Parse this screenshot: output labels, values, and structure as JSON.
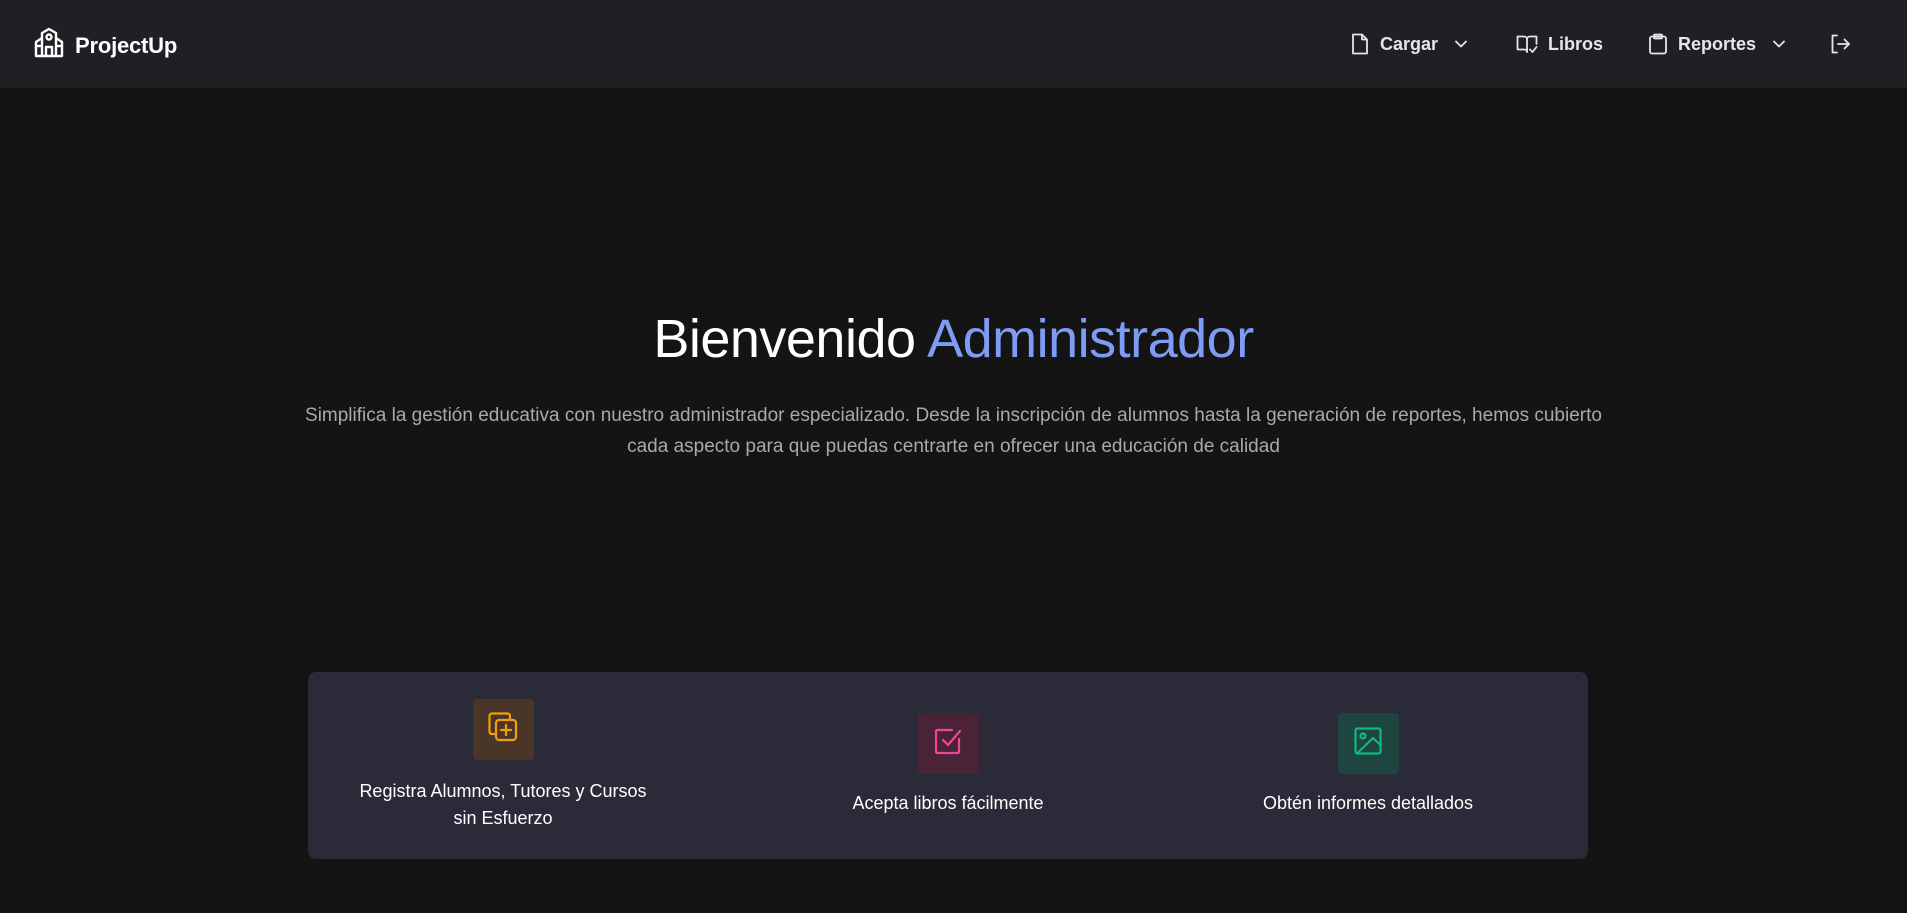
{
  "nav": {
    "brand": "ProjectUp",
    "brand_icon": "school-building-icon",
    "items": [
      {
        "label": "Cargar",
        "icon": "file-icon",
        "has_dropdown": true
      },
      {
        "label": "Libros",
        "icon": "book-icon",
        "has_dropdown": false
      },
      {
        "label": "Reportes",
        "icon": "clipboard-icon",
        "has_dropdown": true
      }
    ],
    "logout_icon": "logout-icon"
  },
  "hero": {
    "title_prefix": "Bienvenido",
    "title_accent": "Administrador",
    "description": "Simplifica la gestión educativa con nuestro administrador especializado. Desde la inscripción de alumnos hasta la generación de reportes, hemos cubierto cada aspecto para que puedas centrarte en ofrecer una educación de calidad"
  },
  "features": [
    {
      "label": "Registra Alumnos, Tutores y Cursos sin Esfuerzo",
      "icon": "copy-plus-icon",
      "color": "#f59e0b"
    },
    {
      "label": "Acepta libros fácilmente",
      "icon": "checkbox-icon",
      "color": "#ec4899"
    },
    {
      "label": "Obtén informes detallados",
      "icon": "image-icon",
      "color": "#10b981"
    }
  ],
  "colors": {
    "accent": "#7f9cf5",
    "navbar_bg": "#1f2024",
    "page_bg": "#141414",
    "card_bg": "#2a2a38"
  }
}
